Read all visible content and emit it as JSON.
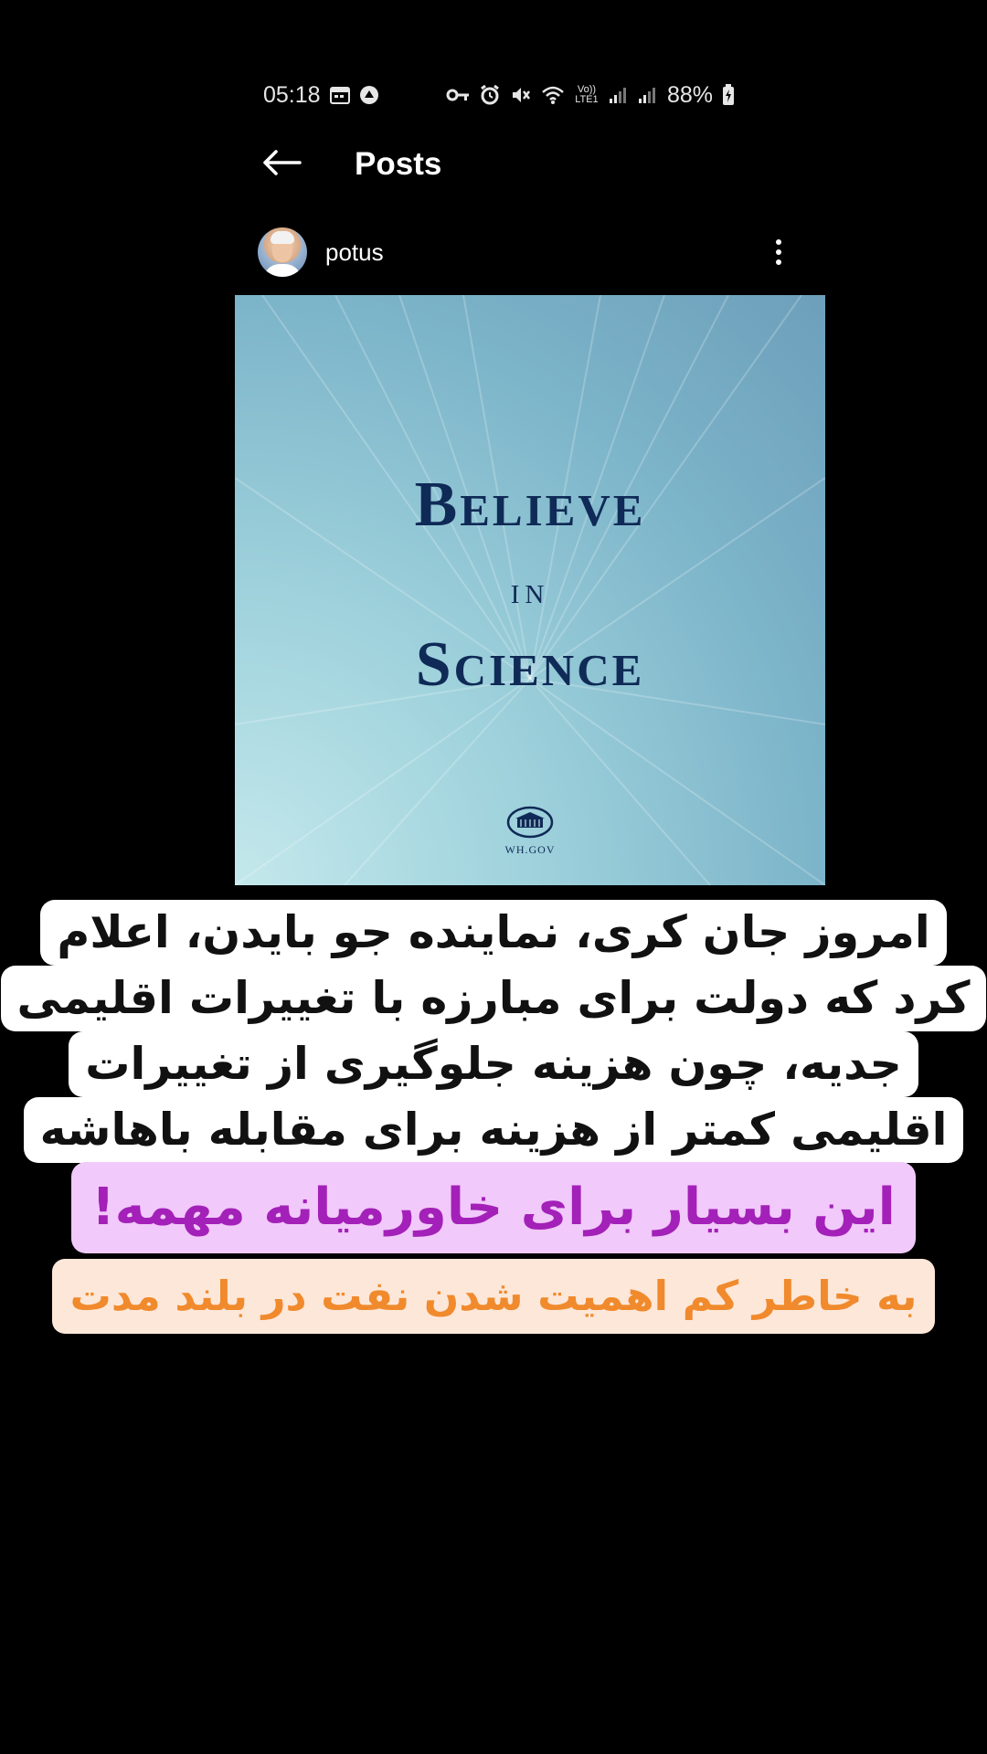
{
  "status_bar": {
    "time": "05:18",
    "network_label": "Vo)) LTE1",
    "battery": "88%"
  },
  "toolbar": {
    "title": "Posts"
  },
  "post": {
    "username": "potus",
    "image": {
      "line1": "Believe",
      "line2": "in",
      "line3": "Science",
      "site_label": "WH.GOV"
    }
  },
  "captions": {
    "main_lines": [
      "امروز جان کری، نماینده جو بایدن، اعلام",
      "کرد که دولت برای مبارزه با تغییرات اقلیمی",
      "جدیه، چون هزینه جلوگیری از تغییرات",
      "اقلیمی کمتر از هزینه برای مقابله باهاشه"
    ],
    "highlight": "این بسیار برای خاورمیانه مهمه!",
    "footnote": "به خاطر کم اهمیت شدن نفت در بلند مدت"
  },
  "colors": {
    "background": "#000000",
    "headline": "#0f2a56",
    "highlight_text": "#a321b8",
    "highlight_bg": "#f1c9fa",
    "footnote_text": "#f08a2c",
    "footnote_bg": "#fde7d9"
  },
  "icons": {
    "back": "arrow-left-icon",
    "more": "more-vertical-icon",
    "status": [
      "calendar-icon",
      "notification-icon",
      "key-icon",
      "alarm-icon",
      "mute-icon",
      "wifi-icon",
      "signal-icon",
      "battery-icon"
    ]
  }
}
